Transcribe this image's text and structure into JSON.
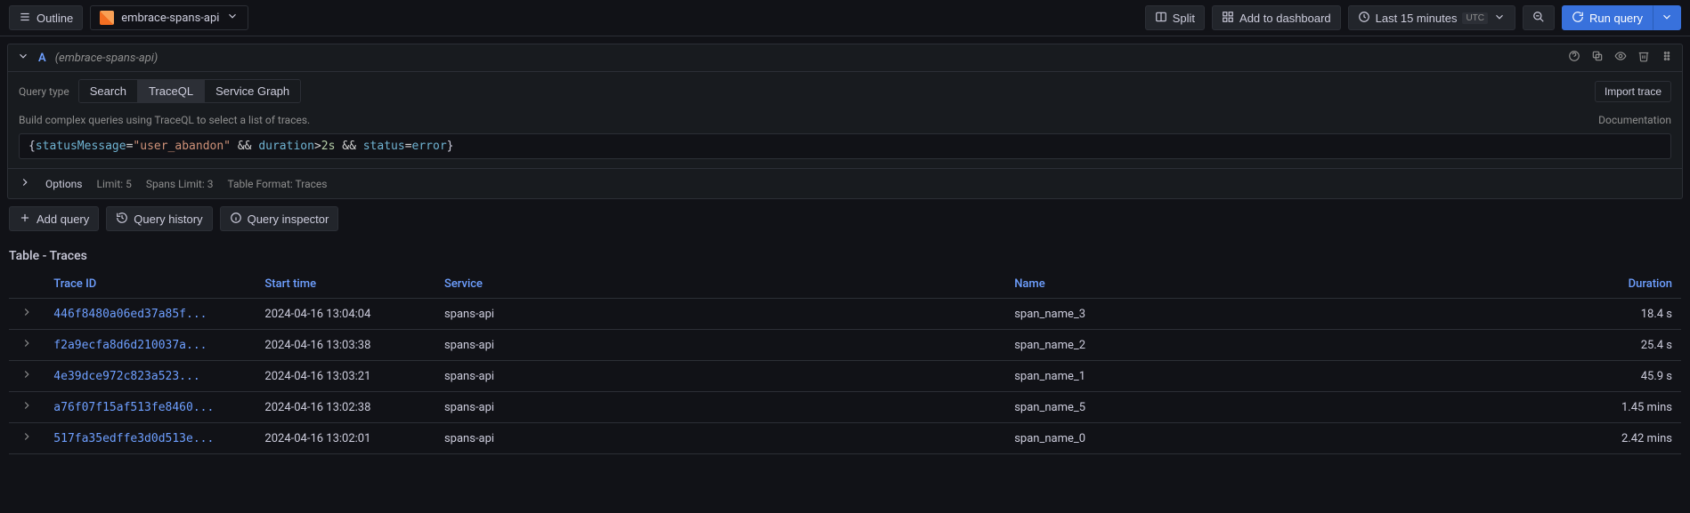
{
  "toolbar": {
    "outline": "Outline",
    "datasource": "embrace-spans-api",
    "split": "Split",
    "add_to_dashboard": "Add to dashboard",
    "time_range": "Last 15 minutes",
    "tz": "UTC",
    "run_query": "Run query"
  },
  "query": {
    "letter": "A",
    "ds_name": "(embrace-spans-api)",
    "type_label": "Query type",
    "tabs": {
      "search": "Search",
      "traceql": "TraceQL",
      "service_graph": "Service Graph"
    },
    "import_trace": "Import trace",
    "hint": "Build complex queries using TraceQL to select a list of traces.",
    "documentation": "Documentation",
    "editor": {
      "open": "{",
      "attr1a": "status",
      "attr1b": "Message",
      "eq1": "=",
      "str": "\"user_abandon\"",
      "and1": " && ",
      "attr2": "duration",
      "op2": ">",
      "val2": "2s",
      "and2": " && ",
      "attr3": "status",
      "eq3": "=",
      "val3": "error",
      "close": "}"
    },
    "options": {
      "label": "Options",
      "limit": "Limit: 5",
      "spans_limit": "Spans Limit: 3",
      "table_format": "Table Format: Traces"
    }
  },
  "actions": {
    "add_query": "Add query",
    "query_history": "Query history",
    "query_inspector": "Query inspector"
  },
  "table": {
    "title": "Table - Traces",
    "headers": {
      "trace_id": "Trace ID",
      "start_time": "Start time",
      "service": "Service",
      "name": "Name",
      "duration": "Duration"
    },
    "rows": [
      {
        "trace_id": "446f8480a06ed37a85f...",
        "start": "2024-04-16 13:04:04",
        "service": "spans-api",
        "name": "span_name_3",
        "duration": "18.4 s"
      },
      {
        "trace_id": "f2a9ecfa8d6d210037a...",
        "start": "2024-04-16 13:03:38",
        "service": "spans-api",
        "name": "span_name_2",
        "duration": "25.4 s"
      },
      {
        "trace_id": "4e39dce972c823a523...",
        "start": "2024-04-16 13:03:21",
        "service": "spans-api",
        "name": "span_name_1",
        "duration": "45.9 s"
      },
      {
        "trace_id": "a76f07f15af513fe8460...",
        "start": "2024-04-16 13:02:38",
        "service": "spans-api",
        "name": "span_name_5",
        "duration": "1.45 mins"
      },
      {
        "trace_id": "517fa35edffe3d0d513e...",
        "start": "2024-04-16 13:02:01",
        "service": "spans-api",
        "name": "span_name_0",
        "duration": "2.42 mins"
      }
    ]
  }
}
